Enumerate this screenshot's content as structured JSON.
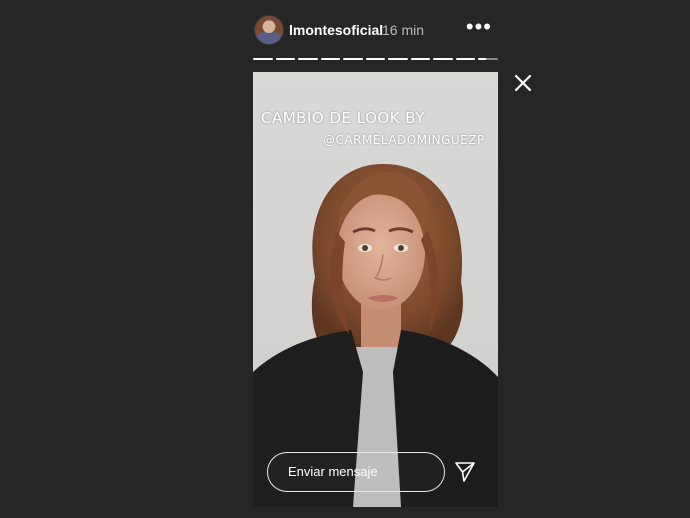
{
  "header": {
    "username": "lmontesoficial",
    "time_ago": "16 min",
    "more_label": "•••"
  },
  "progress": {
    "segments_total": 11,
    "segments_viewed": 10,
    "current_segment_fraction": 0.4
  },
  "story": {
    "caption_line1": "CAMBIO DE LOOK BY",
    "caption_line2": "@CARMELADOMINGUEZP"
  },
  "reply": {
    "placeholder": "Enviar mensaje"
  },
  "icons": {
    "close": "close-icon",
    "send": "send-icon",
    "more": "more-options-icon"
  },
  "colors": {
    "background": "#262626",
    "text": "#ffffff",
    "muted": "#b9b9b9"
  }
}
